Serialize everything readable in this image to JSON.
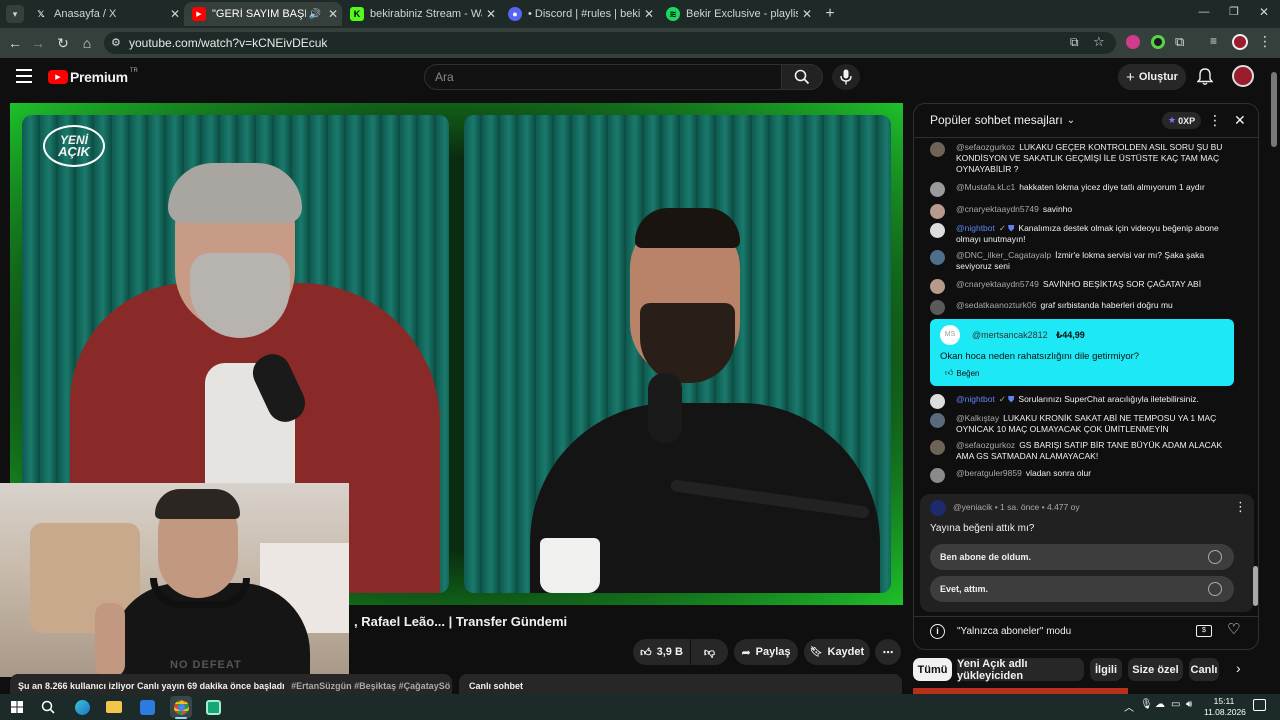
{
  "browser": {
    "tabs": [
      {
        "title": "Anasayfa / X",
        "icon": "x-logo-icon",
        "active": false
      },
      {
        "title": "\"GERİ SAYIM BAŞLADI\" Du",
        "icon": "youtube-icon",
        "active": true
      },
      {
        "title": "bekirabiniz Stream - Watch Live",
        "icon": "kick-icon",
        "active": false
      },
      {
        "title": "• Discord | #rules | bekirabiniz",
        "icon": "discord-icon",
        "active": false
      },
      {
        "title": "Bekir Exclusive - playlist by Bek",
        "icon": "spotify-icon",
        "active": false
      }
    ],
    "url": "youtube.com/watch?v=kCNEivDEcuk"
  },
  "youtube": {
    "logo_text": "Premium",
    "logo_sup": "TR",
    "search_placeholder": "Ara",
    "create_label": "Oluştur",
    "video_title": ", Rafael Leão... | Transfer Gündemi",
    "likes": "3,9 B",
    "share_label": "Paylaş",
    "save_label": "Kaydet",
    "watching_line": "Şu an 8.266 kullanıcı izliyor  Canlı yayın 69 dakika önce başladı",
    "hashtags": "#ErtanSüzgün #Beşiktaş #ÇağataySö",
    "live_chat_label": "Canlı sohbet",
    "logo_overlay_1": "YENİ",
    "logo_overlay_2": "AÇIK",
    "cam_shirt_text": "NO DEFEAT"
  },
  "chat": {
    "header": "Popüler sohbet mesajları",
    "xp_label": "0XP",
    "messages": [
      {
        "author": "@sefaozgurkoz",
        "text": "LUKAKU GEÇER KONTROLDEN ASIL SORU ŞU BU KONDİSYON VE SAKATLIK GEÇMİŞİ İLE ÜSTÜSTE KAÇ TAM MAÇ OYNAYABİLİR ?"
      },
      {
        "author": "@Mustafa.kLc1",
        "text": "hakkaten lokma yicez diye tatlı almıyorum 1 aydır"
      },
      {
        "author": "@cnaryektaaydn5749",
        "text": "savinho"
      },
      {
        "author": "@nightbot",
        "text": "Kanalımıza destek olmak için videoyu beğenip abone olmayı unutmayın!"
      },
      {
        "author": "@DNC_ilker_Cagatayalp",
        "text": "İzmir'e lokma servisi var mı? Şaka şaka seviyoruz seni"
      },
      {
        "author": "@cnaryektaaydn5749",
        "text": "SAVİNHO BEŞİKTAŞ SOR ÇAĞATAY ABİ"
      },
      {
        "author": "@sedatkaanozturk06",
        "text": "graf sırbistanda haberleri doğru mu"
      }
    ],
    "superchat": {
      "initials": "MS",
      "author": "@mertsancak2812",
      "amount": "₺44,99",
      "text": "Okan hoca neden rahatsızlığını dile getirmiyor?",
      "like_label": "Beğen"
    },
    "messages2": [
      {
        "author": "@nightbot",
        "text": "Sorularınızı SuperChat aracılığıyla iletebilirsiniz."
      },
      {
        "author": "@Kalkıştay",
        "text": "LUKAKU KRONİK SAKAT ABİ NE TEMPOSU YA 1 MAÇ OYNİCAK 10 MAÇ OLMAYACAK ÇOK ÜMİTLENMEYİN"
      },
      {
        "author": "@sefaozgurkoz",
        "text": "GS BARIŞI SATIP BİR TANE BÜYÜK ADAM ALACAK AMA GS SATMADAN ALAMAYACAK!"
      },
      {
        "author": "@beratguler9859",
        "text": "vladan sonra olur"
      }
    ],
    "poll": {
      "channel": "@yeniacik",
      "meta": "• 1 sa. önce • 4.477 oy",
      "question": "Yayına beğeni attık mı?",
      "options": [
        "Ben abone de oldum.",
        "Evet, attım."
      ]
    },
    "mode_text": "\"Yalnızca aboneler\" modu"
  },
  "filters": [
    "Tümü",
    "Yeni Açık adlı yükleyiciden",
    "İlgili",
    "Size özel",
    "Canlı"
  ],
  "taskbar": {
    "time": "15:11",
    "date": "11.08.2026"
  }
}
